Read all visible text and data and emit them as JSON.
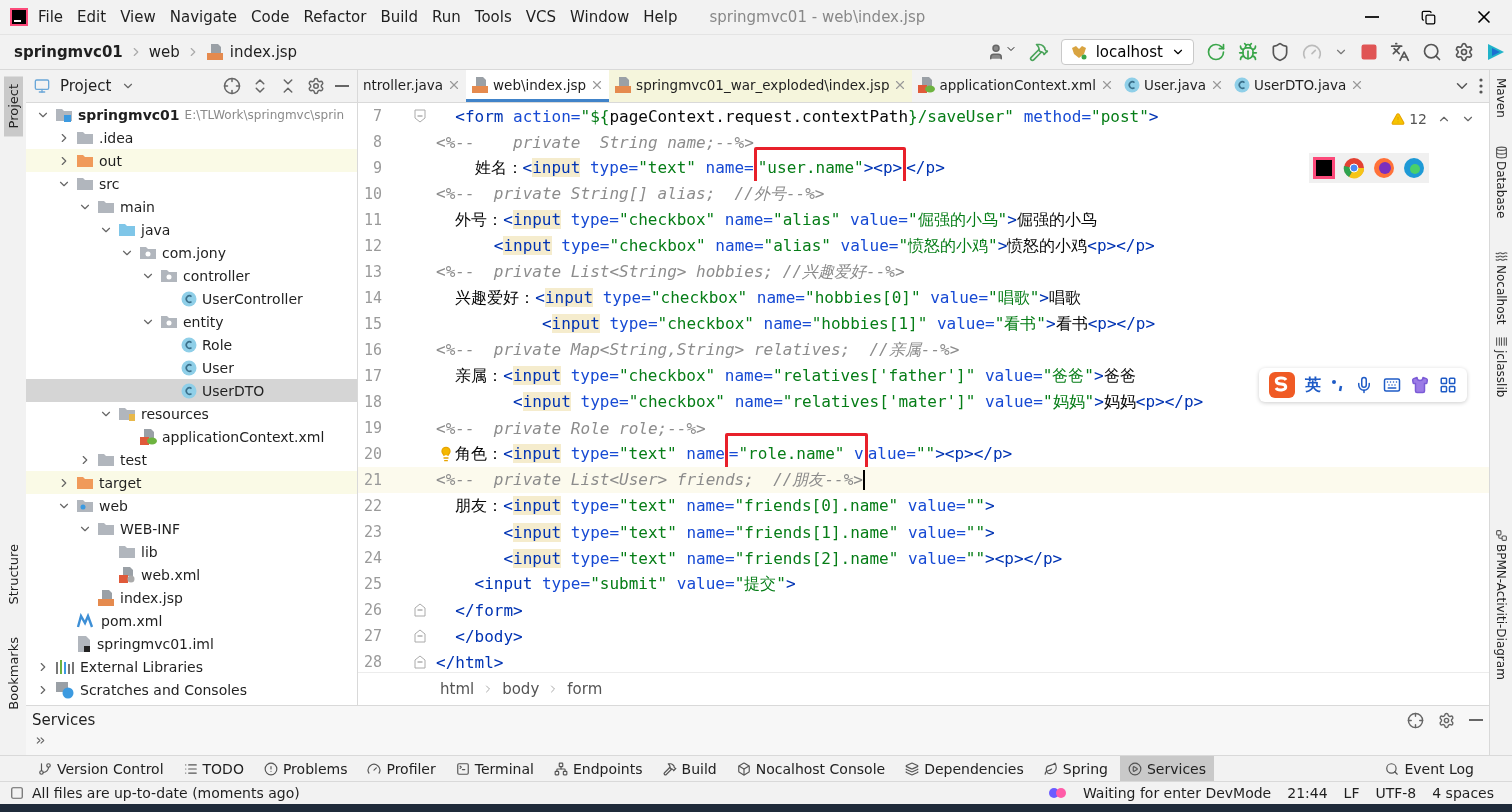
{
  "window": {
    "title": "springmvc01 - web\\index.jsp"
  },
  "menu": [
    "File",
    "Edit",
    "View",
    "Navigate",
    "Code",
    "Refactor",
    "Build",
    "Run",
    "Tools",
    "VCS",
    "Window",
    "Help"
  ],
  "breadcrumb": [
    "springmvc01",
    "web",
    "index.jsp"
  ],
  "run_config": {
    "label": "localhost"
  },
  "left_stripe": [
    {
      "label": "Project",
      "selected": true
    },
    {
      "label": "Structure",
      "selected": false
    },
    {
      "label": "Bookmarks",
      "selected": false
    }
  ],
  "right_stripe": [
    "Maven",
    "Database",
    "Nocalhost",
    "jclasslib",
    "BPMN-Activiti-Diagram"
  ],
  "project": {
    "title": "Project",
    "tree": [
      {
        "label": "springmvc01",
        "kind": "module",
        "path": "E:\\TLWork\\springmvc\\sprin",
        "expanded": true,
        "selected": false,
        "children": [
          {
            "label": ".idea",
            "kind": "folder",
            "expanded": false,
            "selected": false
          },
          {
            "label": "out",
            "kind": "excluded",
            "expanded": false,
            "selected": false
          },
          {
            "label": "src",
            "kind": "folder",
            "expanded": true,
            "selected": false,
            "children": [
              {
                "label": "main",
                "kind": "folder",
                "expanded": true,
                "selected": false,
                "children": [
                  {
                    "label": "java",
                    "kind": "source",
                    "expanded": true,
                    "selected": false,
                    "children": [
                      {
                        "label": "com.jony",
                        "kind": "package",
                        "expanded": true,
                        "selected": false,
                        "children": [
                          {
                            "label": "controller",
                            "kind": "package",
                            "expanded": true,
                            "selected": false,
                            "children": [
                              {
                                "label": "UserController",
                                "kind": "class",
                                "selected": false
                              }
                            ]
                          },
                          {
                            "label": "entity",
                            "kind": "package",
                            "expanded": true,
                            "selected": false,
                            "children": [
                              {
                                "label": "Role",
                                "kind": "class",
                                "selected": false
                              },
                              {
                                "label": "User",
                                "kind": "class",
                                "selected": false
                              },
                              {
                                "label": "UserDTO",
                                "kind": "class",
                                "selected": true
                              }
                            ]
                          }
                        ]
                      }
                    ]
                  },
                  {
                    "label": "resources",
                    "kind": "resources",
                    "expanded": true,
                    "selected": false,
                    "children": [
                      {
                        "label": "applicationContext.xml",
                        "kind": "spring",
                        "selected": false
                      }
                    ]
                  }
                ]
              },
              {
                "label": "test",
                "kind": "folder",
                "expanded": false,
                "selected": false
              }
            ]
          },
          {
            "label": "target",
            "kind": "excluded",
            "expanded": false,
            "selected": false
          },
          {
            "label": "web",
            "kind": "web",
            "expanded": true,
            "selected": false,
            "children": [
              {
                "label": "WEB-INF",
                "kind": "folder",
                "expanded": true,
                "selected": false,
                "children": [
                  {
                    "label": "lib",
                    "kind": "folder",
                    "selected": false
                  },
                  {
                    "label": "web.xml",
                    "kind": "xml",
                    "selected": false
                  }
                ]
              },
              {
                "label": "index.jsp",
                "kind": "jsp",
                "selected": false
              }
            ]
          },
          {
            "label": "pom.xml",
            "kind": "maven",
            "selected": false
          },
          {
            "label": "springmvc01.iml",
            "kind": "iml",
            "selected": false
          }
        ]
      },
      {
        "label": "External Libraries",
        "kind": "libraries",
        "expanded": false,
        "selected": false
      },
      {
        "label": "Scratches and Consoles",
        "kind": "scratches",
        "expanded": false,
        "selected": false
      }
    ]
  },
  "tabs": [
    {
      "label": "ntroller.java",
      "kind": "cut",
      "selected": false,
      "external": false
    },
    {
      "label": "web\\index.jsp",
      "kind": "jsp",
      "selected": true,
      "external": false
    },
    {
      "label": "springmvc01_war_exploded\\index.jsp",
      "kind": "jsp",
      "selected": false,
      "external": true
    },
    {
      "label": "applicationContext.xml",
      "kind": "spring",
      "selected": false,
      "external": false
    },
    {
      "label": "User.java",
      "kind": "class",
      "selected": false,
      "external": false
    },
    {
      "label": "UserDTO.java",
      "kind": "class",
      "selected": false,
      "external": false
    }
  ],
  "editor": {
    "warnings": "12",
    "ime": {
      "label": "英"
    },
    "lines": [
      {
        "number": "7",
        "current": false,
        "kind": "fold-start",
        "tokens": [
          {
            "kind": "tag",
            "text": "  <form"
          },
          {
            "kind": "attr",
            "text": " action="
          },
          {
            "kind": "str",
            "text": "\"${"
          },
          {
            "kind": "plain",
            "text": "pageContext.request.contextPath"
          },
          {
            "kind": "str",
            "text": "}/saveUser\""
          },
          {
            "kind": "attr",
            "text": " method="
          },
          {
            "kind": "str",
            "text": "\"post\""
          },
          {
            "kind": "tag",
            "text": ">"
          }
        ]
      },
      {
        "number": "8",
        "current": false,
        "kind": "code",
        "tokens": [
          {
            "kind": "comment",
            "text": "<%--    private  String name;--%>"
          }
        ]
      },
      {
        "number": "9",
        "current": false,
        "kind": "code",
        "tokens": [
          {
            "kind": "plain",
            "text": "    姓名："
          },
          {
            "kind": "tag",
            "text": "<"
          },
          {
            "kind": "hl",
            "text": "input"
          },
          {
            "kind": "attr",
            "text": " type="
          },
          {
            "kind": "str",
            "text": "\"text\""
          },
          {
            "kind": "attr",
            "text": " name="
          },
          {
            "kind": "box",
            "children": [
              {
                "kind": "str",
                "text": "\"user.name\""
              },
              {
                "kind": "tag",
                "text": "><p>"
              }
            ]
          },
          {
            "kind": "tag",
            "text": "</p>"
          }
        ]
      },
      {
        "number": "10",
        "current": false,
        "kind": "code",
        "tokens": [
          {
            "kind": "comment",
            "text": "<%--  private String[] alias;  //外号--%>"
          }
        ]
      },
      {
        "number": "11",
        "current": false,
        "kind": "code",
        "tokens": [
          {
            "kind": "plain",
            "text": "  外号："
          },
          {
            "kind": "tag",
            "text": "<"
          },
          {
            "kind": "hl",
            "text": "input"
          },
          {
            "kind": "attr",
            "text": " type="
          },
          {
            "kind": "str",
            "text": "\"checkbox\""
          },
          {
            "kind": "attr",
            "text": " name="
          },
          {
            "kind": "str",
            "text": "\"alias\""
          },
          {
            "kind": "attr",
            "text": " value="
          },
          {
            "kind": "str",
            "text": "\"倔强的小鸟\""
          },
          {
            "kind": "tag",
            "text": ">"
          },
          {
            "kind": "plain",
            "text": "倔强的小鸟"
          }
        ]
      },
      {
        "number": "12",
        "current": false,
        "kind": "code",
        "tokens": [
          {
            "kind": "tag",
            "text": "      <"
          },
          {
            "kind": "hl",
            "text": "input"
          },
          {
            "kind": "attr",
            "text": " type="
          },
          {
            "kind": "str",
            "text": "\"checkbox\""
          },
          {
            "kind": "attr",
            "text": " name="
          },
          {
            "kind": "str",
            "text": "\"alias\""
          },
          {
            "kind": "attr",
            "text": " value="
          },
          {
            "kind": "str",
            "text": "\"愤怒的小鸡\""
          },
          {
            "kind": "tag",
            "text": ">"
          },
          {
            "kind": "plain",
            "text": "愤怒的小鸡"
          },
          {
            "kind": "tag",
            "text": "<p></p>"
          }
        ]
      },
      {
        "number": "13",
        "current": false,
        "kind": "code",
        "tokens": [
          {
            "kind": "comment",
            "text": "<%--  private List<String> hobbies; //兴趣爱好--%>"
          }
        ]
      },
      {
        "number": "14",
        "current": false,
        "kind": "code",
        "tokens": [
          {
            "kind": "plain",
            "text": "  兴趣爱好："
          },
          {
            "kind": "tag",
            "text": "<"
          },
          {
            "kind": "hl",
            "text": "input"
          },
          {
            "kind": "attr",
            "text": " type="
          },
          {
            "kind": "str",
            "text": "\"checkbox\""
          },
          {
            "kind": "attr",
            "text": " name="
          },
          {
            "kind": "str",
            "text": "\"hobbies[0]\""
          },
          {
            "kind": "attr",
            "text": " value="
          },
          {
            "kind": "str",
            "text": "\"唱歌\""
          },
          {
            "kind": "tag",
            "text": ">"
          },
          {
            "kind": "plain",
            "text": "唱歌"
          }
        ]
      },
      {
        "number": "15",
        "current": false,
        "kind": "code",
        "tokens": [
          {
            "kind": "tag",
            "text": "           <"
          },
          {
            "kind": "hl",
            "text": "input"
          },
          {
            "kind": "attr",
            "text": " type="
          },
          {
            "kind": "str",
            "text": "\"checkbox\""
          },
          {
            "kind": "attr",
            "text": " name="
          },
          {
            "kind": "str",
            "text": "\"hobbies[1]\""
          },
          {
            "kind": "attr",
            "text": " value="
          },
          {
            "kind": "str",
            "text": "\"看书\""
          },
          {
            "kind": "tag",
            "text": ">"
          },
          {
            "kind": "plain",
            "text": "看书"
          },
          {
            "kind": "tag",
            "text": "<p></p>"
          }
        ]
      },
      {
        "number": "16",
        "current": false,
        "kind": "code",
        "tokens": [
          {
            "kind": "comment",
            "text": "<%--  private Map<String,String> relatives;  //亲属--%>"
          }
        ]
      },
      {
        "number": "17",
        "current": false,
        "kind": "code",
        "tokens": [
          {
            "kind": "plain",
            "text": "  亲属："
          },
          {
            "kind": "tag",
            "text": "<"
          },
          {
            "kind": "hl",
            "text": "input"
          },
          {
            "kind": "attr",
            "text": " type="
          },
          {
            "kind": "str",
            "text": "\"checkbox\""
          },
          {
            "kind": "attr",
            "text": " name="
          },
          {
            "kind": "str",
            "text": "\"relatives['father']\""
          },
          {
            "kind": "attr",
            "text": " value="
          },
          {
            "kind": "str",
            "text": "\"爸爸\""
          },
          {
            "kind": "tag",
            "text": ">"
          },
          {
            "kind": "plain",
            "text": "爸爸"
          }
        ]
      },
      {
        "number": "18",
        "current": false,
        "kind": "code",
        "tokens": [
          {
            "kind": "tag",
            "text": "        <"
          },
          {
            "kind": "hl",
            "text": "input"
          },
          {
            "kind": "attr",
            "text": " type="
          },
          {
            "kind": "str",
            "text": "\"checkbox\""
          },
          {
            "kind": "attr",
            "text": " name="
          },
          {
            "kind": "str",
            "text": "\"relatives['mater']\""
          },
          {
            "kind": "attr",
            "text": " value="
          },
          {
            "kind": "str",
            "text": "\"妈妈\""
          },
          {
            "kind": "tag",
            "text": ">"
          },
          {
            "kind": "plain",
            "text": "妈妈"
          },
          {
            "kind": "tag",
            "text": "<p></p>"
          }
        ]
      },
      {
        "number": "19",
        "current": false,
        "kind": "code",
        "tokens": [
          {
            "kind": "comment",
            "text": "<%--  private Role role;--%>"
          }
        ]
      },
      {
        "number": "20",
        "current": false,
        "kind": "bulb",
        "tokens": [
          {
            "kind": "plain",
            "text": "  角色："
          },
          {
            "kind": "tag",
            "text": "<"
          },
          {
            "kind": "hl",
            "text": "input"
          },
          {
            "kind": "attr",
            "text": " type="
          },
          {
            "kind": "str",
            "text": "\"text\""
          },
          {
            "kind": "attr",
            "text": " name"
          },
          {
            "kind": "box",
            "children": [
              {
                "kind": "attr",
                "text": "="
              },
              {
                "kind": "str",
                "text": "\"role.name\""
              },
              {
                "kind": "attr",
                "text": " v"
              }
            ]
          },
          {
            "kind": "attr",
            "text": "alue="
          },
          {
            "kind": "str",
            "text": "\"\""
          },
          {
            "kind": "tag",
            "text": "><p></p>"
          }
        ]
      },
      {
        "number": "21",
        "current": true,
        "kind": "code",
        "tokens": [
          {
            "kind": "comment",
            "text": "<%--  private List<User> friends;  //朋友--%>"
          }
        ]
      },
      {
        "number": "22",
        "current": false,
        "kind": "code",
        "tokens": [
          {
            "kind": "plain",
            "text": "  朋友："
          },
          {
            "kind": "tag",
            "text": "<"
          },
          {
            "kind": "hl",
            "text": "input"
          },
          {
            "kind": "attr",
            "text": " type="
          },
          {
            "kind": "str",
            "text": "\"text\""
          },
          {
            "kind": "attr",
            "text": " name="
          },
          {
            "kind": "str",
            "text": "\"friends[0].name\""
          },
          {
            "kind": "attr",
            "text": " value="
          },
          {
            "kind": "str",
            "text": "\"\""
          },
          {
            "kind": "tag",
            "text": ">"
          }
        ]
      },
      {
        "number": "23",
        "current": false,
        "kind": "code",
        "tokens": [
          {
            "kind": "tag",
            "text": "       <"
          },
          {
            "kind": "hl",
            "text": "input"
          },
          {
            "kind": "attr",
            "text": " type="
          },
          {
            "kind": "str",
            "text": "\"text\""
          },
          {
            "kind": "attr",
            "text": " name="
          },
          {
            "kind": "str",
            "text": "\"friends[1].name\""
          },
          {
            "kind": "attr",
            "text": " value="
          },
          {
            "kind": "str",
            "text": "\"\""
          },
          {
            "kind": "tag",
            "text": ">"
          }
        ]
      },
      {
        "number": "24",
        "current": false,
        "kind": "code",
        "tokens": [
          {
            "kind": "tag",
            "text": "       <"
          },
          {
            "kind": "hl",
            "text": "input"
          },
          {
            "kind": "attr",
            "text": " type="
          },
          {
            "kind": "str",
            "text": "\"text\""
          },
          {
            "kind": "attr",
            "text": " name="
          },
          {
            "kind": "str",
            "text": "\"friends[2].name\""
          },
          {
            "kind": "attr",
            "text": " value="
          },
          {
            "kind": "str",
            "text": "\"\""
          },
          {
            "kind": "tag",
            "text": "><p></p>"
          }
        ]
      },
      {
        "number": "25",
        "current": false,
        "kind": "code",
        "tokens": [
          {
            "kind": "tag",
            "text": "    <input"
          },
          {
            "kind": "attr",
            "text": " type="
          },
          {
            "kind": "str",
            "text": "\"submit\""
          },
          {
            "kind": "attr",
            "text": " value="
          },
          {
            "kind": "str",
            "text": "\"提交\""
          },
          {
            "kind": "tag",
            "text": ">"
          }
        ]
      },
      {
        "number": "26",
        "current": false,
        "kind": "fold-end",
        "tokens": [
          {
            "kind": "tag",
            "text": "  </form>"
          }
        ]
      },
      {
        "number": "27",
        "current": false,
        "kind": "fold-end",
        "tokens": [
          {
            "kind": "tag",
            "text": "  </body>"
          }
        ]
      },
      {
        "number": "28",
        "current": false,
        "kind": "fold-end",
        "tokens": [
          {
            "kind": "tag",
            "text": "</html>"
          }
        ]
      }
    ],
    "path": [
      "html",
      "body",
      "form"
    ]
  },
  "services": {
    "title": "Services"
  },
  "tool_windows": [
    {
      "label": "Version Control",
      "kind": "branch",
      "selected": false
    },
    {
      "label": "TODO",
      "kind": "list",
      "selected": false
    },
    {
      "label": "Problems",
      "kind": "alert",
      "selected": false
    },
    {
      "label": "Profiler",
      "kind": "gauge",
      "selected": false
    },
    {
      "label": "Terminal",
      "kind": "terminal",
      "selected": false
    },
    {
      "label": "Endpoints",
      "kind": "network",
      "selected": false
    },
    {
      "label": "Build",
      "kind": "hammer",
      "selected": false
    },
    {
      "label": "Nocalhost Console",
      "kind": "box",
      "selected": false
    },
    {
      "label": "Dependencies",
      "kind": "layers",
      "selected": false
    },
    {
      "label": "Spring",
      "kind": "leaf",
      "selected": false
    },
    {
      "label": "Services",
      "kind": "play",
      "selected": true
    },
    {
      "label": "Event Log",
      "kind": "search",
      "selected": false
    }
  ],
  "status_bar": {
    "message": "All files are up-to-date (moments ago)",
    "devmode": "Waiting for enter DevMode",
    "position": "21:44",
    "line_separator": "LF",
    "encoding": "UTF-8",
    "indent": "4 spaces"
  }
}
